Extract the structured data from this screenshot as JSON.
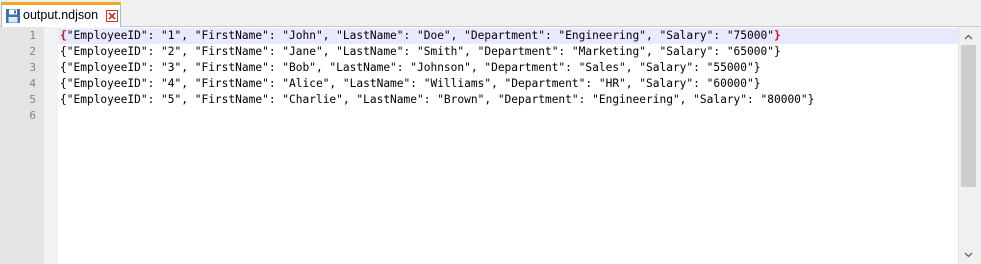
{
  "tab": {
    "title": "output.ndjson",
    "icon": "floppy-disk-icon",
    "close_icon": "close-icon"
  },
  "editor": {
    "line_numbers": [
      "1",
      "2",
      "3",
      "4",
      "5",
      "6"
    ],
    "lines": [
      {
        "open": "{",
        "body": "\"EmployeeID\": \"1\", \"FirstName\": \"John\", \"LastName\": \"Doe\", \"Department\": \"Engineering\", \"Salary\": \"75000\"",
        "close": "}"
      },
      {
        "open": "{",
        "body": "\"EmployeeID\": \"2\", \"FirstName\": \"Jane\", \"LastName\": \"Smith\", \"Department\": \"Marketing\", \"Salary\": \"65000\"",
        "close": "}"
      },
      {
        "open": "{",
        "body": "\"EmployeeID\": \"3\", \"FirstName\": \"Bob\", \"LastName\": \"Johnson\", \"Department\": \"Sales\", \"Salary\": \"55000\"",
        "close": "}"
      },
      {
        "open": "{",
        "body": "\"EmployeeID\": \"4\", \"FirstName\": \"Alice\", \"LastName\": \"Williams\", \"Department\": \"HR\", \"Salary\": \"60000\"",
        "close": "}"
      },
      {
        "open": "{",
        "body": "\"EmployeeID\": \"5\", \"FirstName\": \"Charlie\", \"LastName\": \"Brown\", \"Department\": \"Engineering\", \"Salary\": \"80000\"",
        "close": "}"
      },
      {
        "open": "",
        "body": "",
        "close": ""
      }
    ],
    "current_line": "1"
  },
  "colors": {
    "brace_match": "#ff0000",
    "current_line_bg": "#e8e8ff",
    "tab_accent": "#f5a623"
  }
}
